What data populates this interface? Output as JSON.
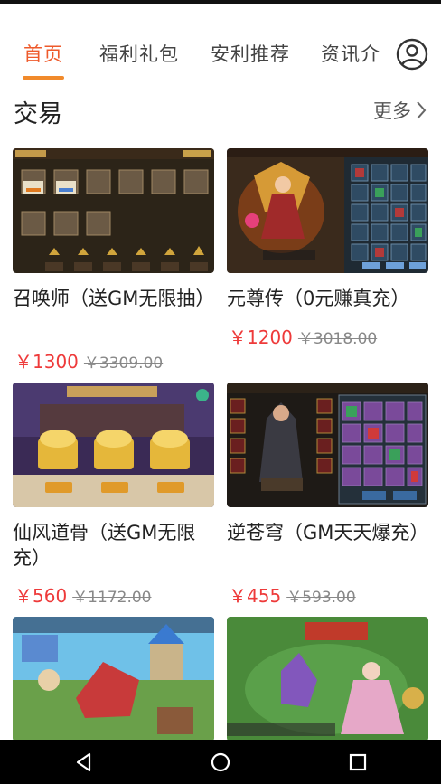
{
  "nav": {
    "tabs": [
      {
        "label": "首页",
        "active": true
      },
      {
        "label": "福利礼包",
        "active": false
      },
      {
        "label": "安利推荐",
        "active": false
      },
      {
        "label": "资讯介",
        "active": false
      }
    ],
    "profile_icon": "user-circle-icon"
  },
  "section": {
    "title": "交易",
    "more_label": "更多",
    "more_icon": "chevron-right-icon"
  },
  "products": [
    {
      "title": "召唤师（送GM无限抽）",
      "price": "￥1300",
      "original_price": "￥3309.00"
    },
    {
      "title": "元尊传（0元赚真充）",
      "price": "￥1200",
      "original_price": "￥3018.00"
    },
    {
      "title": "仙风道骨（送GM无限充）",
      "price": "￥560",
      "original_price": "￥1172.00"
    },
    {
      "title": "逆苍穹（GM天天爆充）",
      "price": "￥455",
      "original_price": "￥593.00"
    },
    {
      "title": "",
      "price": "",
      "original_price": ""
    },
    {
      "title": "",
      "price": "",
      "original_price": ""
    }
  ],
  "colors": {
    "accent": "#ee5a2b",
    "tab_underline": "#f18a2b",
    "price": "#ee3a3a",
    "strikethrough": "#888888"
  },
  "system_nav": {
    "back_icon": "back-triangle-icon",
    "home_icon": "home-circle-icon",
    "recents_icon": "recents-square-icon"
  }
}
